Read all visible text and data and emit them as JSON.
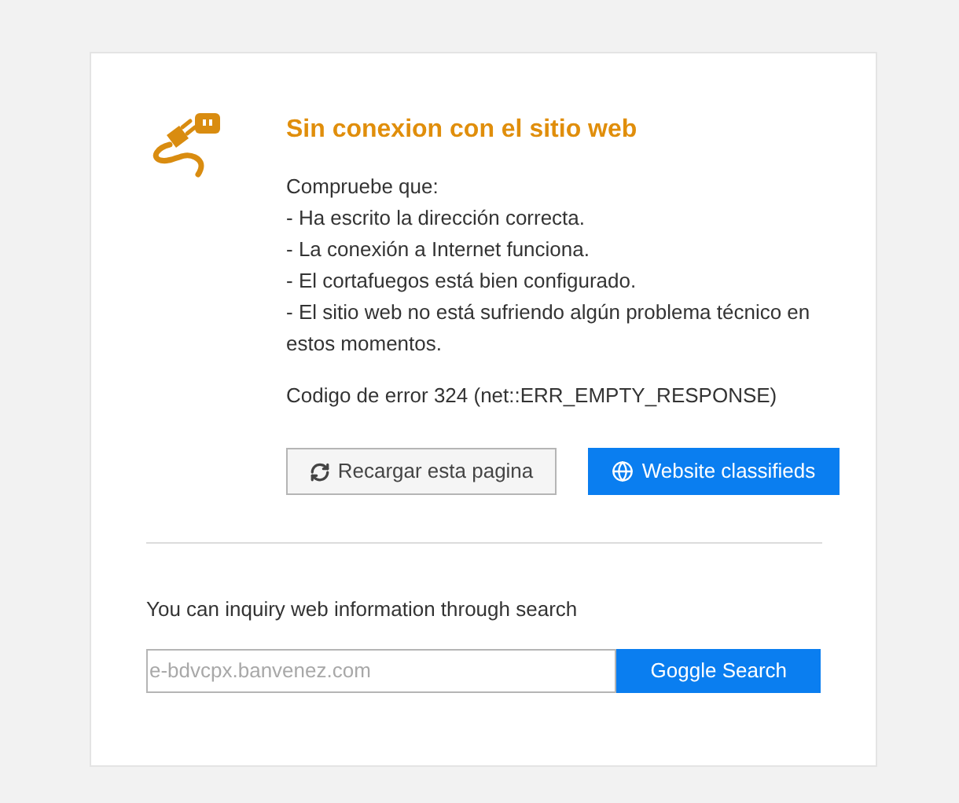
{
  "title": "Sin conexion con el sitio web",
  "intro": "Compruebe que:",
  "checks": [
    "- Ha escrito la dirección correcta.",
    "- La conexión a Internet funciona.",
    "- El cortafuegos está bien configurado.",
    "- El sitio web no está sufriendo algún problema técnico en estos momentos."
  ],
  "error_code": "Codigo de error 324 (net::ERR_EMPTY_RESPONSE)",
  "buttons": [
    {
      "kind": "reload",
      "label": "Recargar esta pagina"
    },
    {
      "kind": "globe",
      "label": "Website classifieds"
    }
  ],
  "search": {
    "label": "You can inquiry web information through search",
    "placeholder": "e-bdvcpx.banvenez.com",
    "button": "Goggle Search"
  }
}
